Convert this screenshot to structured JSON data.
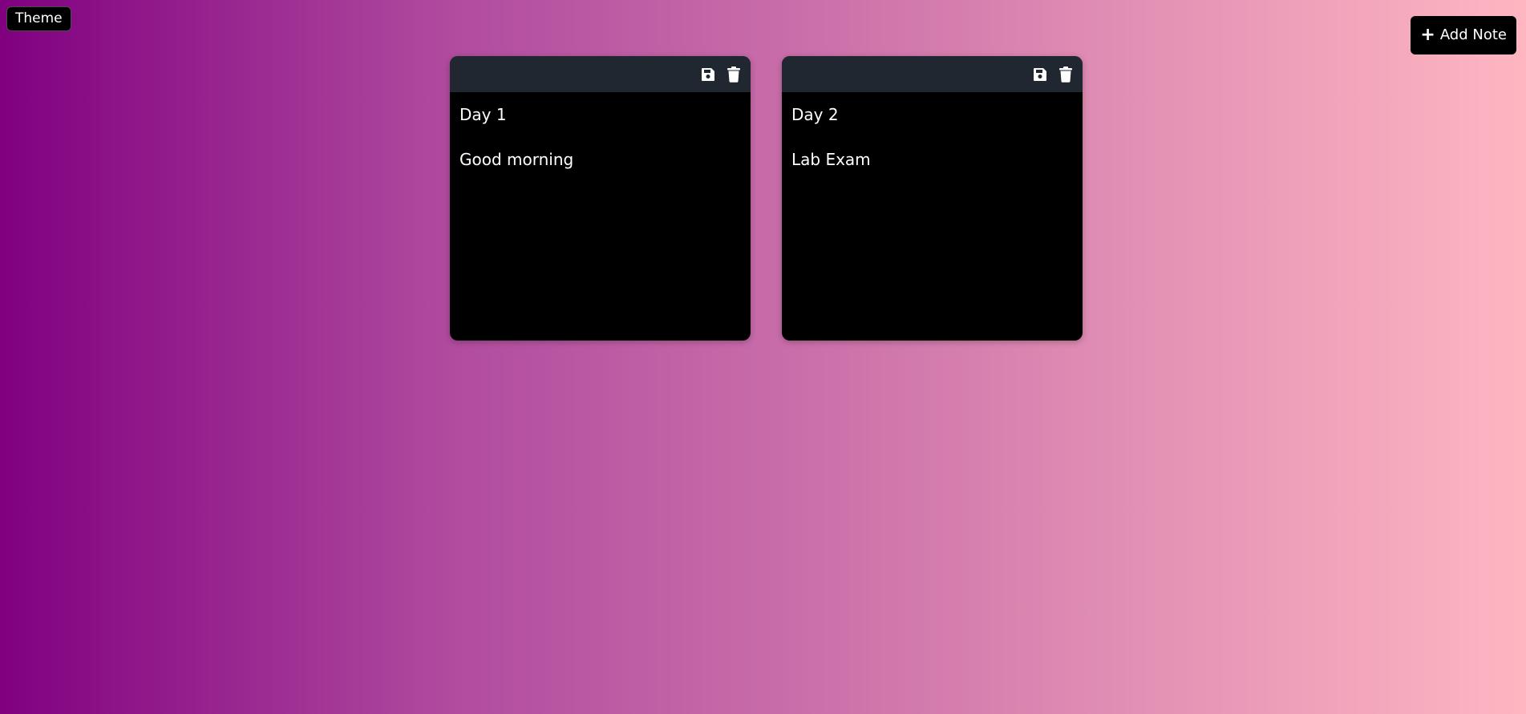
{
  "toolbar": {
    "theme_label": "Theme",
    "add_note_label": "Add Note",
    "add_icon": "plus-icon"
  },
  "notes": [
    {
      "title": "Day 1",
      "content": "Good morning",
      "icons": [
        "save-icon",
        "trash-icon"
      ]
    },
    {
      "title": "Day 2",
      "content": "Lab Exam",
      "icons": [
        "save-icon",
        "trash-icon"
      ]
    }
  ],
  "colors": {
    "background_start": "#800080",
    "background_end": "#ffb6c1",
    "note_background": "#000000",
    "note_header": "#212730",
    "text": "#ffffff"
  }
}
